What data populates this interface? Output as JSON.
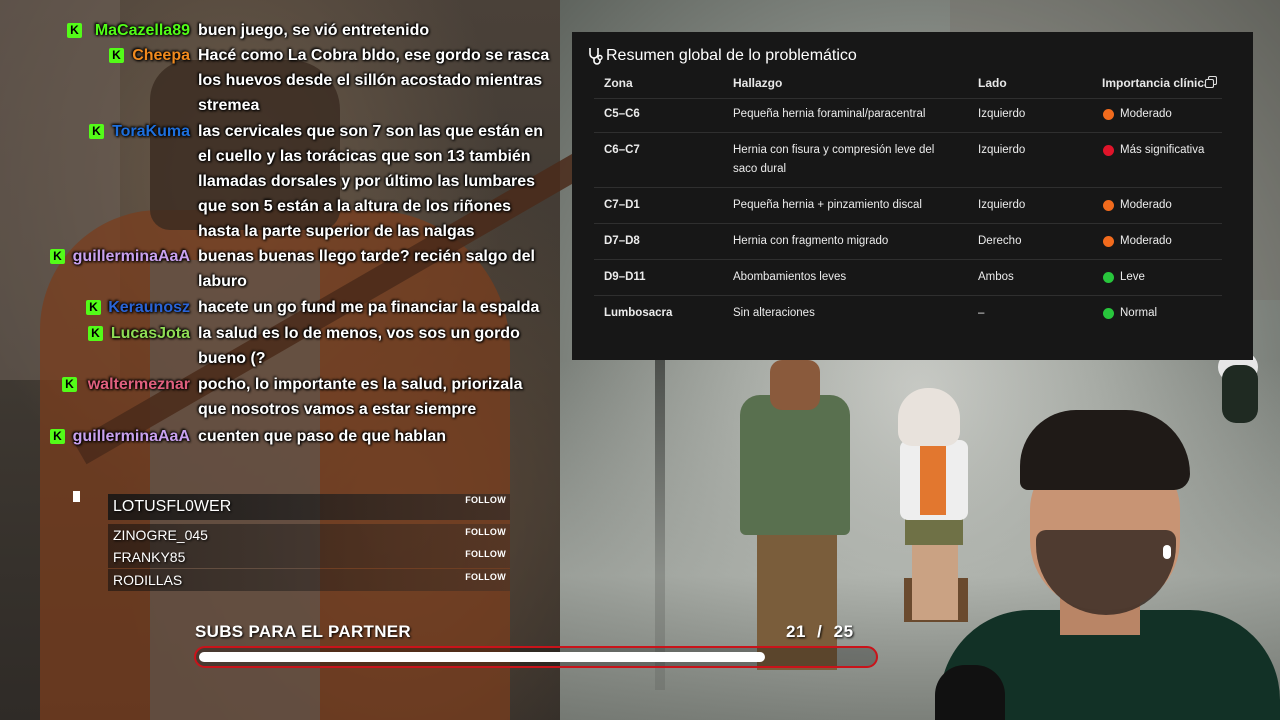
{
  "chat": [
    {
      "user": "MaCazella89",
      "user_color": "#53fc18",
      "text": "buen juego, se vió entretenido"
    },
    {
      "user": "Cheepa",
      "user_color": "#f08a1e",
      "text": "Hacé como La Cobra bldo, ese gordo se rasca los huevos desde el sillón acostado mientras stremea"
    },
    {
      "user": "ToraKuma",
      "user_color": "#1e6fdc",
      "text": "las cervicales que son 7 son las que están en el cuello y las torácicas que son 13 también llamadas dorsales y por último las lumbares que son 5 están a la altura de los riñones hasta la parte superior de las nalgas"
    },
    {
      "user": "guillerminaAaA",
      "user_color": "#c8a1ee",
      "text": "buenas buenas llego tarde? recién salgo del laburo"
    },
    {
      "user": "Keraunosz",
      "user_color": "#2a64d6",
      "text": "hacete un go fund me pa financiar la espalda"
    },
    {
      "user": "LucasJota",
      "user_color": "#8fdc55",
      "text": "la salud es lo de menos, vos sos un gordo bueno (?"
    },
    {
      "user": "waltermeznar",
      "user_color": "#e0607e",
      "text": "pocho, lo importante es la salud, priorizala que nosotros vamos a estar siempre"
    },
    {
      "user": "guillerminaAaA",
      "user_color": "#c8a1ee",
      "text": "cuenten que paso de que hablan"
    }
  ],
  "followers": {
    "top": {
      "name": "LOTUSFL0WER",
      "button": "FOLLOW"
    },
    "rows": [
      {
        "name": "ZINOGRE_045",
        "button": "FOLLOW"
      },
      {
        "name": "FRANKY85",
        "button": "FOLLOW"
      },
      {
        "name": "RODILLAS",
        "button": "FOLLOW"
      }
    ]
  },
  "goal": {
    "title": "SUBS PARA EL PARTNER",
    "current": "21",
    "separator": "/",
    "target": "25",
    "progress": 0.84
  },
  "summary": {
    "title": "Resumen global de lo problemático",
    "icon": "stethoscope-icon",
    "headers": {
      "zone": "Zona",
      "finding": "Hallazgo",
      "side": "Lado",
      "importance": "Importancia clínica"
    },
    "rows": [
      {
        "zone": "C5–C6",
        "finding": "Pequeña hernia foraminal/paracentral",
        "side": "Izquierdo",
        "importance": "Moderado",
        "color": "#f26b1d"
      },
      {
        "zone": "C6–C7",
        "finding": "Hernia con fisura y compresión leve del saco dural",
        "side": "Izquierdo",
        "importance": "Más significativa",
        "color": "#e0142a"
      },
      {
        "zone": "C7–D1",
        "finding": "Pequeña hernia + pinzamiento discal",
        "side": "Izquierdo",
        "importance": "Moderado",
        "color": "#f26b1d"
      },
      {
        "zone": "D7–D8",
        "finding": "Hernia con fragmento migrado",
        "side": "Derecho",
        "importance": "Moderado",
        "color": "#f26b1d"
      },
      {
        "zone": "D9–D11",
        "finding": "Abombamientos leves",
        "side": "Ambos",
        "importance": "Leve",
        "color": "#28c63c"
      },
      {
        "zone": "Lumbosacra",
        "finding": "Sin alteraciones",
        "side": "–",
        "importance": "Normal",
        "color": "#28c63c"
      }
    ]
  }
}
